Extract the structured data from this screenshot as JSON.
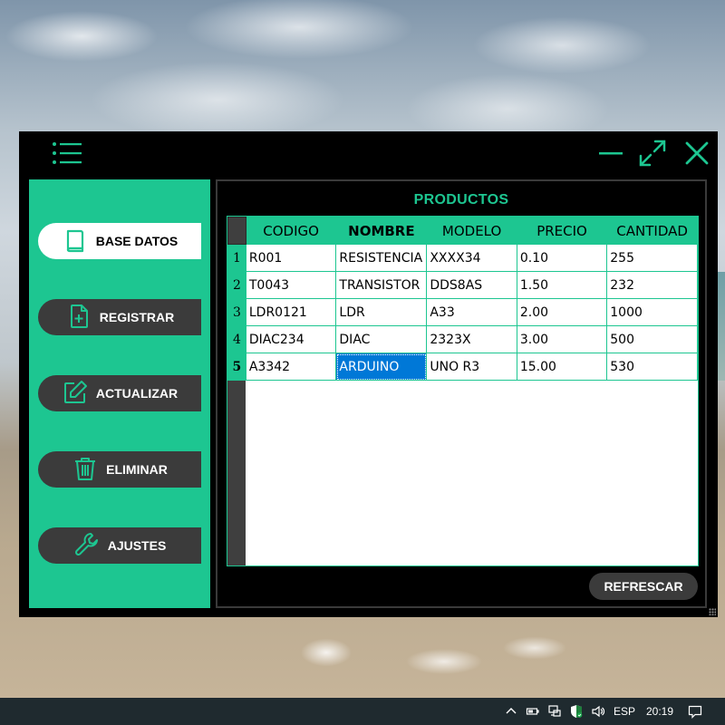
{
  "window": {
    "title": "PRODUCTOS"
  },
  "sidebar": {
    "items": [
      {
        "label": "BASE DATOS",
        "icon": "book-icon",
        "active": true
      },
      {
        "label": "REGISTRAR",
        "icon": "file-plus-icon",
        "active": false
      },
      {
        "label": "ACTUALIZAR",
        "icon": "edit-icon",
        "active": false
      },
      {
        "label": "ELIMINAR",
        "icon": "trash-icon",
        "active": false
      },
      {
        "label": "AJUSTES",
        "icon": "wrench-icon",
        "active": false
      }
    ]
  },
  "table": {
    "columns": [
      "CODIGO",
      "NOMBRE",
      "MODELO",
      "PRECIO",
      "CANTIDAD"
    ],
    "rows": [
      {
        "num": "1",
        "cells": [
          "R001",
          "RESISTENCIA",
          "XXXX34",
          "0.10",
          "255"
        ]
      },
      {
        "num": "2",
        "cells": [
          "T0043",
          "TRANSISTOR",
          "DDS8AS",
          "1.50",
          "232"
        ]
      },
      {
        "num": "3",
        "cells": [
          "LDR0121",
          "LDR",
          "A33",
          "2.00",
          "1000"
        ]
      },
      {
        "num": "4",
        "cells": [
          "DIAC234",
          "DIAC",
          "2323X",
          "3.00",
          "500"
        ]
      },
      {
        "num": "5",
        "cells": [
          "A3342",
          "ARDUINO",
          "UNO R3",
          "15.00",
          "530"
        ]
      }
    ],
    "selected_cell": "ARDUINO"
  },
  "buttons": {
    "refresh": "REFRESCAR"
  },
  "taskbar": {
    "language": "ESP",
    "time": "20:19"
  },
  "colors": {
    "accent": "#1dc691",
    "window_bg": "#000000",
    "button_dark": "#3b3b3b",
    "selection": "#0078d7"
  }
}
